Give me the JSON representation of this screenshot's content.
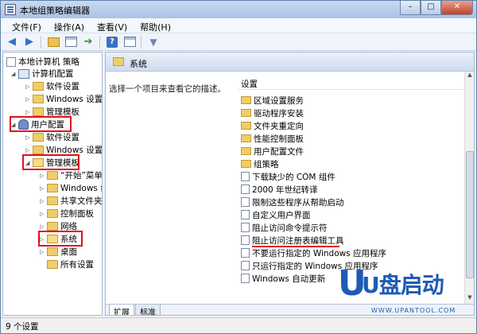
{
  "window": {
    "title": "本地组策略编辑器",
    "controls": {
      "minimize": "–",
      "maximize": "□",
      "close": "✕"
    }
  },
  "menu": [
    "文件(F)",
    "操作(A)",
    "查看(V)",
    "帮助(H)"
  ],
  "toolbar": {
    "icons": [
      "back-arrow-icon",
      "forward-arrow-icon",
      "folder-up-icon",
      "show-hide-tree-icon",
      "export-list-icon",
      "help-icon",
      "properties-icon",
      "filter-icon"
    ]
  },
  "tree": {
    "root": "本地计算机 策略",
    "computer_config": "计算机配置",
    "computer_children": [
      "软件设置",
      "Windows 设置",
      "管理模板"
    ],
    "user_config": "用户配置",
    "user_children": [
      "软件设置",
      "Windows 设置"
    ],
    "admin_templates": "管理模板",
    "admin_children": [
      "“开始”菜单",
      "Windows 组",
      "共享文件夹",
      "控制面板",
      "网络",
      "系统",
      "桌面",
      "所有设置"
    ]
  },
  "right_pane": {
    "header_title": "系统",
    "description": "选择一个项目来查看它的描述。",
    "column_header": "设置",
    "folders": [
      "区域设置服务",
      "驱动程序安装",
      "文件夹重定向",
      "性能控制面板",
      "用户配置文件",
      "组策略"
    ],
    "settings": [
      "下载缺少的 COM 组件",
      "2000 年世纪转译",
      "限制这些程序从帮助启动",
      "自定义用户界面",
      "阻止访问命令提示符",
      "阻止访问注册表编辑工具",
      "不要运行指定的 Windows 应用程序",
      "只运行指定的 Windows 应用程序",
      "Windows 自动更新"
    ],
    "tabs": [
      "扩展",
      "标准"
    ]
  },
  "status": "9 个设置",
  "watermark": {
    "brand": "U盘启动",
    "url": "WWW.UPANTOOL.COM"
  },
  "colors": {
    "highlight": "#e0101e",
    "folder": "#efcd6a",
    "accent": "#3a6fc4"
  }
}
